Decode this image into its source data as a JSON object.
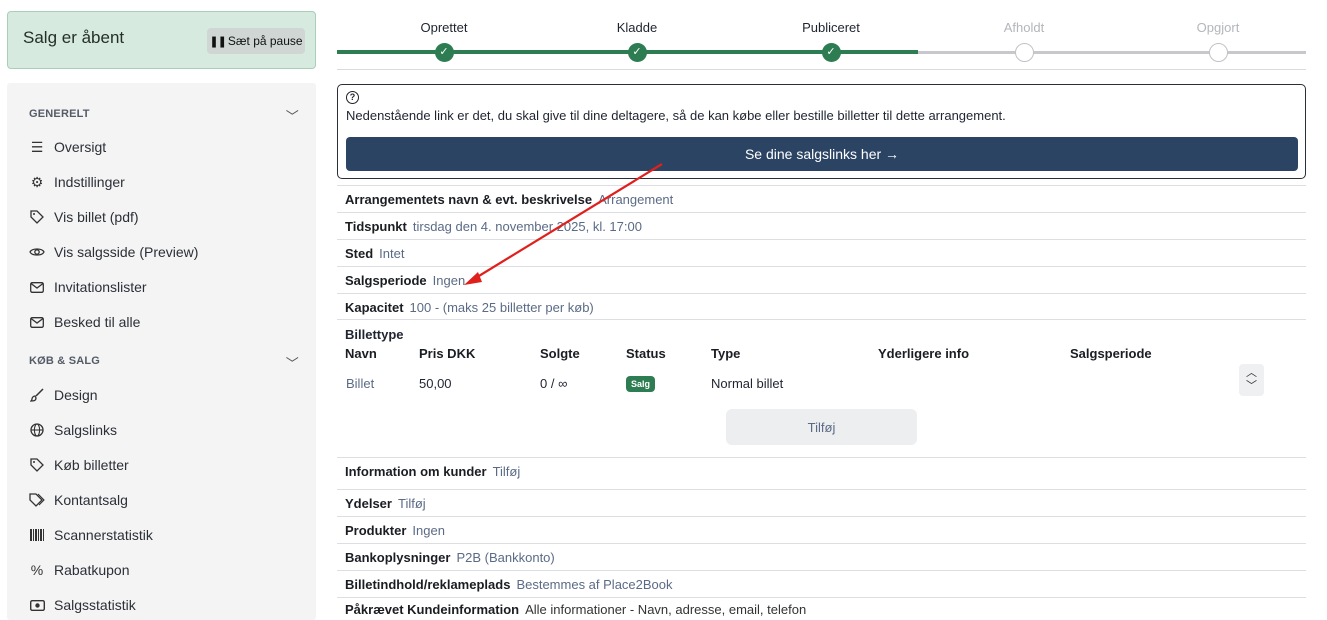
{
  "sale_status": {
    "title": "Salg er åbent",
    "pause_label": "Sæt på pause",
    "pause_icon": "pause-icon"
  },
  "sidebar": {
    "sections": [
      {
        "heading": "GENERELT",
        "items": [
          {
            "label": "Oversigt",
            "icon": "list-icon"
          },
          {
            "label": "Indstillinger",
            "icon": "gear-icon"
          },
          {
            "label": "Vis billet (pdf)",
            "icon": "tag-icon"
          },
          {
            "label": "Vis salgsside (Preview)",
            "icon": "eye-icon"
          },
          {
            "label": "Invitationslister",
            "icon": "envelope-icon"
          },
          {
            "label": "Besked til alle",
            "icon": "envelope-icon"
          }
        ]
      },
      {
        "heading": "KØB & SALG",
        "items": [
          {
            "label": "Design",
            "icon": "brush-icon"
          },
          {
            "label": "Salgslinks",
            "icon": "globe-icon"
          },
          {
            "label": "Køb billetter",
            "icon": "tag-icon"
          },
          {
            "label": "Kontantsalg",
            "icon": "tags-icon"
          },
          {
            "label": "Scannerstatistik",
            "icon": "barcode-icon"
          },
          {
            "label": "Rabatkupon",
            "icon": "percent-icon"
          },
          {
            "label": "Salgsstatistik",
            "icon": "money-icon"
          }
        ]
      }
    ]
  },
  "steps": [
    {
      "label": "Oprettet",
      "done": true
    },
    {
      "label": "Kladde",
      "done": true
    },
    {
      "label": "Publiceret",
      "done": true
    },
    {
      "label": "Afholdt",
      "done": false
    },
    {
      "label": "Opgjort",
      "done": false
    }
  ],
  "info": {
    "text": "Nedenstående link er det, du skal give til dine deltagere, så de kan købe eller bestille billetter til dette arrangement.",
    "button_label": "Se dine salgslinks her →"
  },
  "properties_top": [
    {
      "key": "Arrangementets navn & evt. beskrivelse",
      "value": "Arrangement"
    },
    {
      "key": "Tidspunkt",
      "value": "tirsdag den 4. november 2025, kl. 17:00"
    },
    {
      "key": "Sted",
      "value": "Intet"
    },
    {
      "key": "Salgsperiode",
      "value": "Ingen"
    },
    {
      "key": "Kapacitet",
      "value": "100 - (maks 25 billetter per køb)"
    }
  ],
  "ticket_types": {
    "title": "Billettype",
    "columns": [
      "Navn",
      "Pris DKK",
      "Solgte",
      "Status",
      "Type",
      "Yderligere info",
      "Salgsperiode"
    ],
    "rows": [
      {
        "name": "Billet",
        "price": "50,00",
        "sold": "0 / ∞",
        "status": "Salg",
        "type": "Normal billet",
        "info": "",
        "period": ""
      }
    ],
    "add_label": "Tilføj"
  },
  "properties_bottom": [
    {
      "key": "Information om kunder",
      "value": "Tilføj"
    },
    {
      "key": "Ydelser",
      "value": "Tilføj"
    },
    {
      "key": "Produkter",
      "value": "Ingen"
    },
    {
      "key": "Bankoplysninger",
      "value": "P2B (Bankkonto)"
    },
    {
      "key": "Billetindhold/reklameplads",
      "value": "Bestemmes af Place2Book"
    },
    {
      "key": "Påkrævet Kundeinformation",
      "value": "Alle informationer - Navn, adresse, email, telefon"
    }
  ],
  "colors": {
    "accent_green": "#2e7d52",
    "button_navy": "#2c4463",
    "link": "#5b6b86",
    "annotation_arrow": "#e0201c"
  }
}
